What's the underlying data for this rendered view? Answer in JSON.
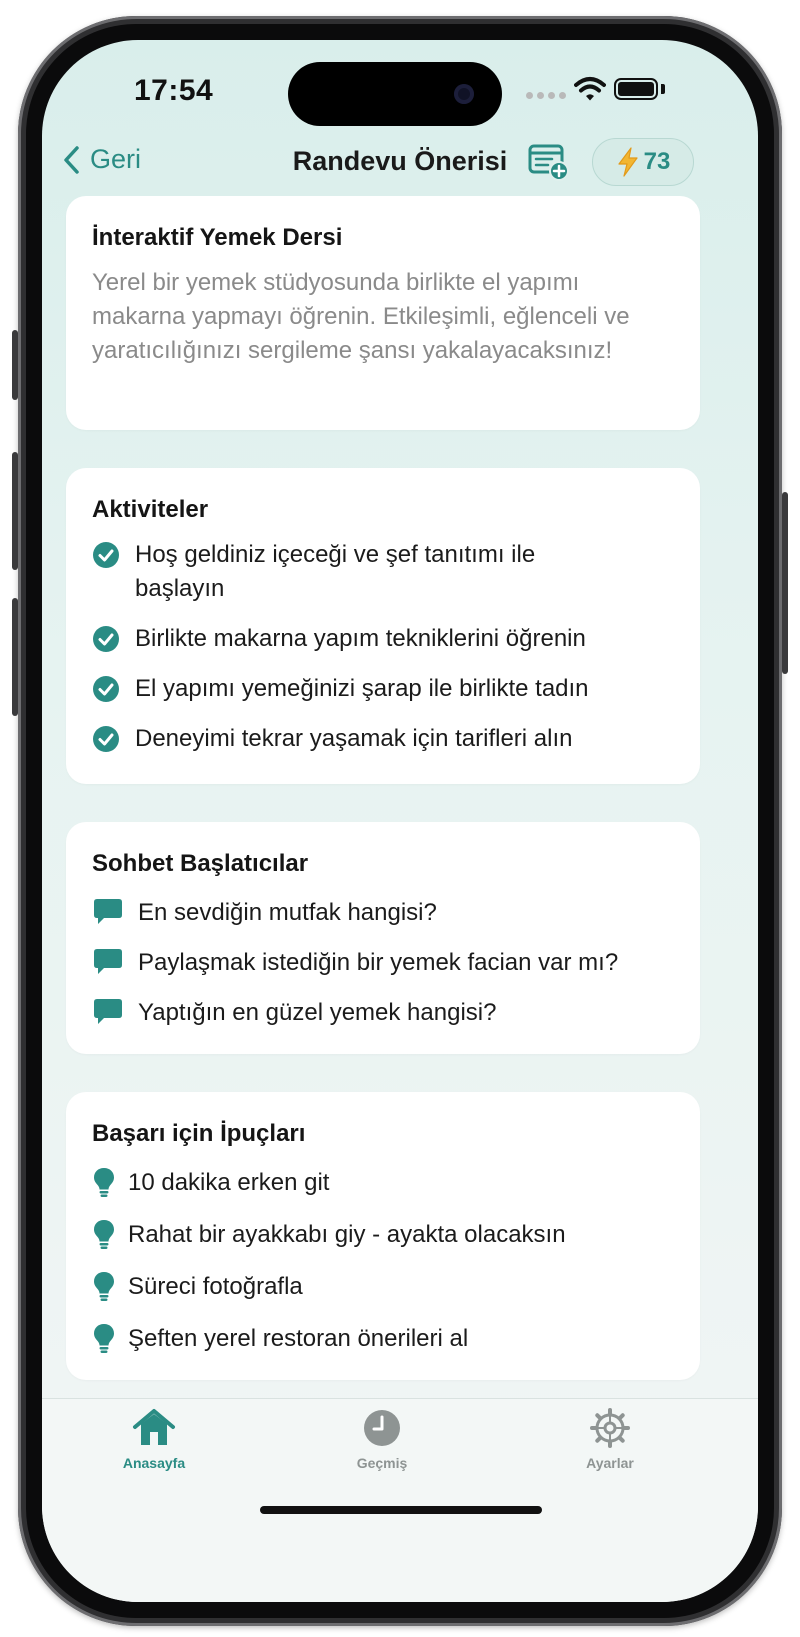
{
  "status_bar": {
    "time": "17:54"
  },
  "nav": {
    "back_label": "Geri",
    "title": "Randevu Önerisi",
    "credits": "73"
  },
  "idea": {
    "title": "İnteraktif Yemek Dersi",
    "description": "Yerel bir yemek stüdyosunda birlikte el yapımı makarna yapmayı öğrenin. Etkileşimli, eğlenceli ve yaratıcılığınızı sergileme şansı yakalayacaksınız!"
  },
  "activities": {
    "title": "Aktiviteler",
    "items": [
      "Hoş geldiniz içeceği ve şef tanıtımı ile başlayın",
      "Birlikte makarna yapım tekniklerini öğrenin",
      "El yapımı yemeğinizi şarap ile birlikte tadın",
      "Deneyimi tekrar yaşamak için tarifleri alın"
    ]
  },
  "conversation": {
    "title": "Sohbet Başlatıcılar",
    "items": [
      "En sevdiğin mutfak hangisi?",
      "Paylaşmak istediğin bir yemek facian var mı?",
      "Yaptığın en güzel yemek hangisi?"
    ]
  },
  "tips": {
    "title": "Başarı için İpuçları",
    "items": [
      "10 dakika erken git",
      "Rahat bir ayakkabı giy - ayakta olacaksın",
      "Süreci fotoğrafla",
      "Şeften yerel restoran önerileri al"
    ]
  },
  "tabs": [
    {
      "label": "Anasayfa",
      "icon": "home-icon",
      "active": true
    },
    {
      "label": "Geçmiş",
      "icon": "clock-icon",
      "active": false
    },
    {
      "label": "Ayarlar",
      "icon": "gear-icon",
      "active": false
    }
  ],
  "colors": {
    "accent": "#2a8c84",
    "inactive": "#8e9493",
    "bolt": "#f2b632"
  }
}
